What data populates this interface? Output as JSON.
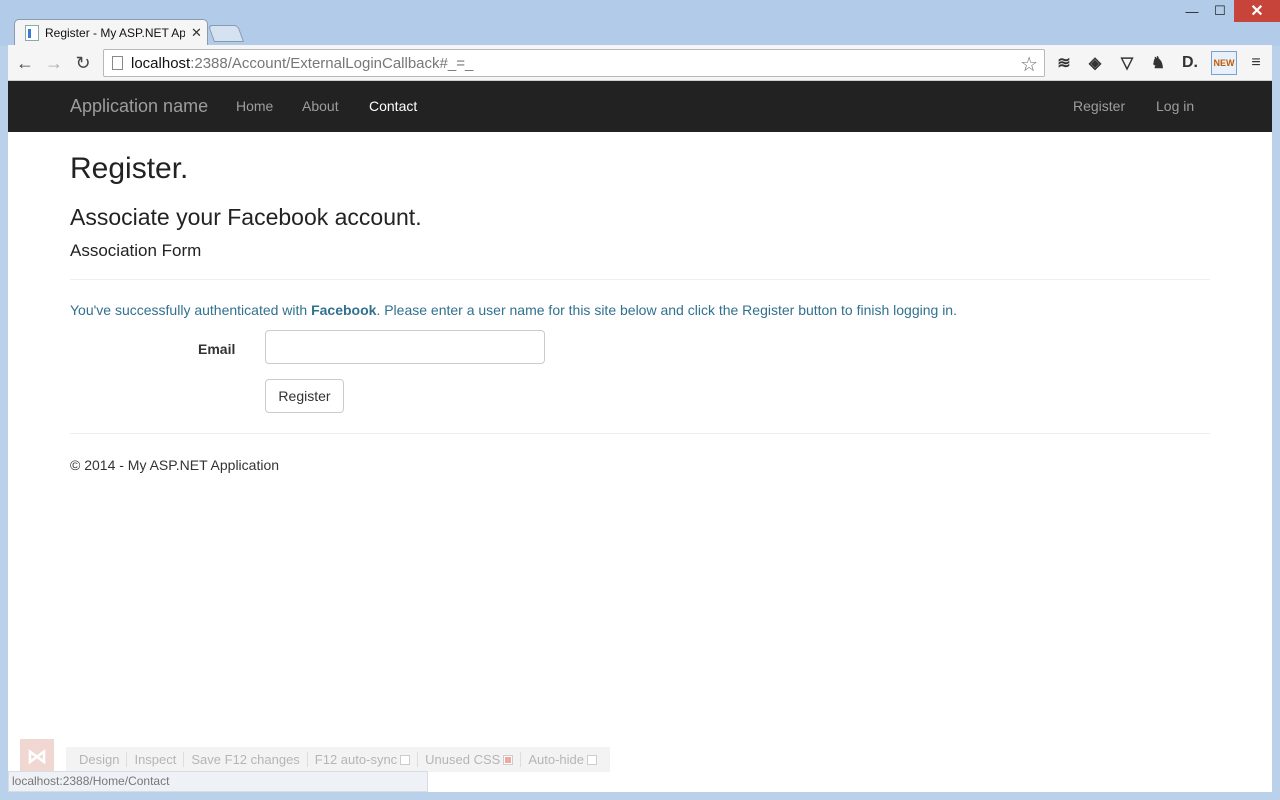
{
  "browser": {
    "tab_title": "Register - My ASP.NET Ap",
    "url_host": "localhost",
    "url_path": ":2388/Account/ExternalLoginCallback#_=_",
    "ext_new_badge": "NEW",
    "status_url": "localhost:2388/Home/Contact"
  },
  "navbar": {
    "brand": "Application name",
    "links": [
      "Home",
      "About",
      "Contact"
    ],
    "register": "Register",
    "login": "Log in"
  },
  "page": {
    "title": "Register.",
    "subtitle": "Associate your Facebook account.",
    "section": "Association Form",
    "info_prefix": "You've successfully authenticated with ",
    "info_provider": "Facebook",
    "info_suffix": ". Please enter a user name for this site below and click the Register button to finish logging in.",
    "email_label": "Email",
    "email_value": "",
    "register_button": "Register",
    "footer": "© 2014 - My ASP.NET Application"
  },
  "browser_link": {
    "items": [
      "Design",
      "Inspect",
      "Save F12 changes",
      "F12 auto-sync",
      "Unused CSS",
      "Auto-hide"
    ]
  }
}
